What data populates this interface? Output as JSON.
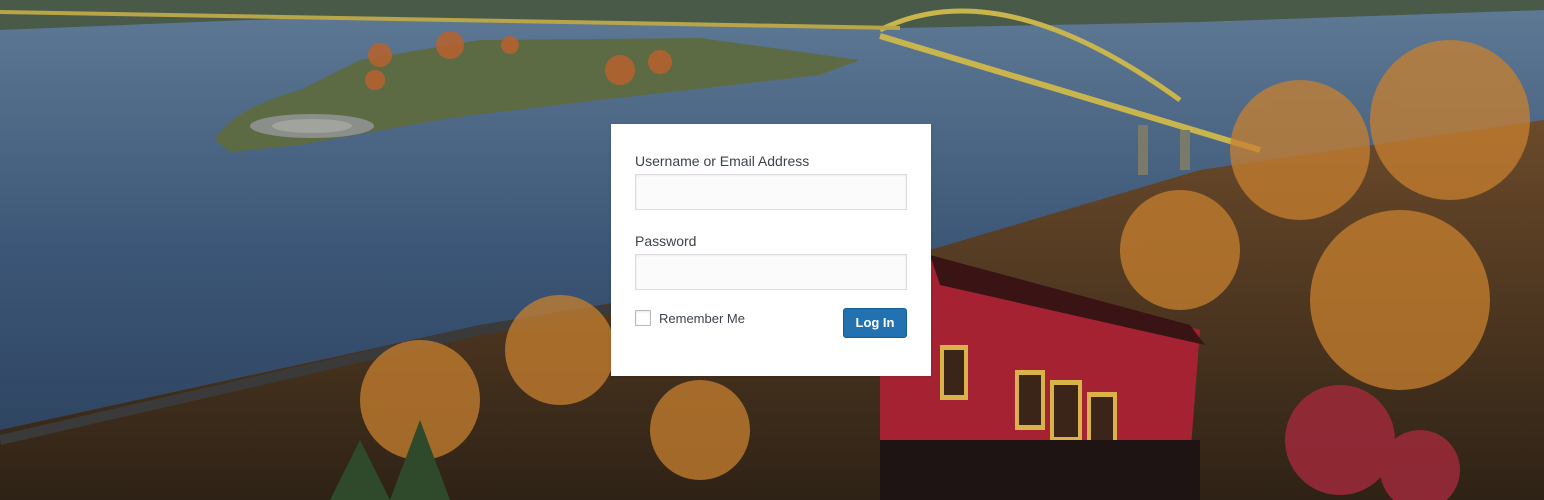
{
  "login": {
    "username_label": "Username or Email Address",
    "username_value": "",
    "password_label": "Password",
    "password_value": "",
    "remember_label": "Remember Me",
    "submit_label": "Log In"
  },
  "colors": {
    "button": "#2271b1",
    "card": "#ffffff"
  }
}
